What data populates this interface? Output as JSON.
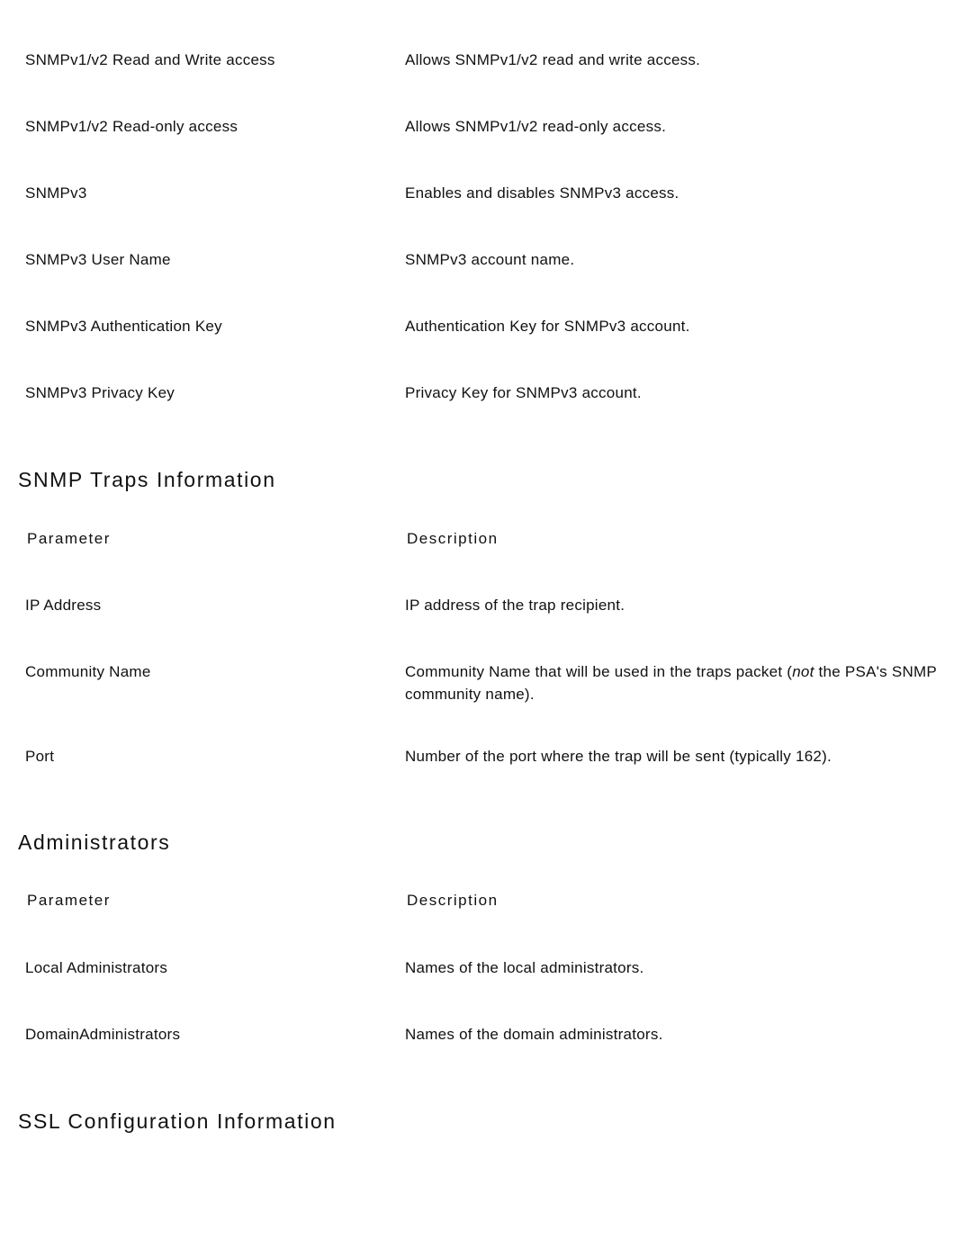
{
  "document": {
    "type": "reference-table-page",
    "background_color": "#ffffff",
    "text_color": "#111111"
  },
  "snmp_access_rows": [
    {
      "parameter": "SNMPv1/v2 Read and Write access",
      "description": "Allows SNMPv1/v2 read and write access."
    },
    {
      "parameter": "SNMPv1/v2 Read-only access",
      "description": "Allows SNMPv1/v2 read-only access."
    },
    {
      "parameter": "SNMPv3",
      "description": "Enables and disables SNMPv3 access."
    },
    {
      "parameter": "SNMPv3 User Name",
      "description": "SNMPv3 account name."
    },
    {
      "parameter": "SNMPv3 Authentication Key",
      "description": "Authentication Key for SNMPv3 account."
    },
    {
      "parameter": "SNMPv3 Privacy Key",
      "description": "Privacy Key for SNMPv3 account."
    }
  ],
  "snmp_traps_section": {
    "heading": "SNMP Traps Information",
    "columns": {
      "parameter": "Parameter",
      "description": "Description"
    },
    "rows": [
      {
        "parameter": "IP Address",
        "description": "IP address of the trap recipient."
      },
      {
        "parameter": "Community Name",
        "description_part1": "Community Name that will be used in the traps packet (",
        "description_italic": "not",
        "description_part2": " the PSA's SNMP community name)."
      },
      {
        "parameter": "Port",
        "description": "Number of the port where the trap will be sent (typically 162)."
      }
    ]
  },
  "administrators_section": {
    "heading": "Administrators",
    "columns": {
      "parameter": "Parameter",
      "description": "Description"
    },
    "rows": [
      {
        "parameter": "Local Administrators",
        "description": "Names of the local administrators."
      },
      {
        "parameter": "DomainAdministrators",
        "description": "Names of the domain administrators."
      }
    ]
  },
  "ssl_section": {
    "heading": "SSL Configuration Information"
  }
}
